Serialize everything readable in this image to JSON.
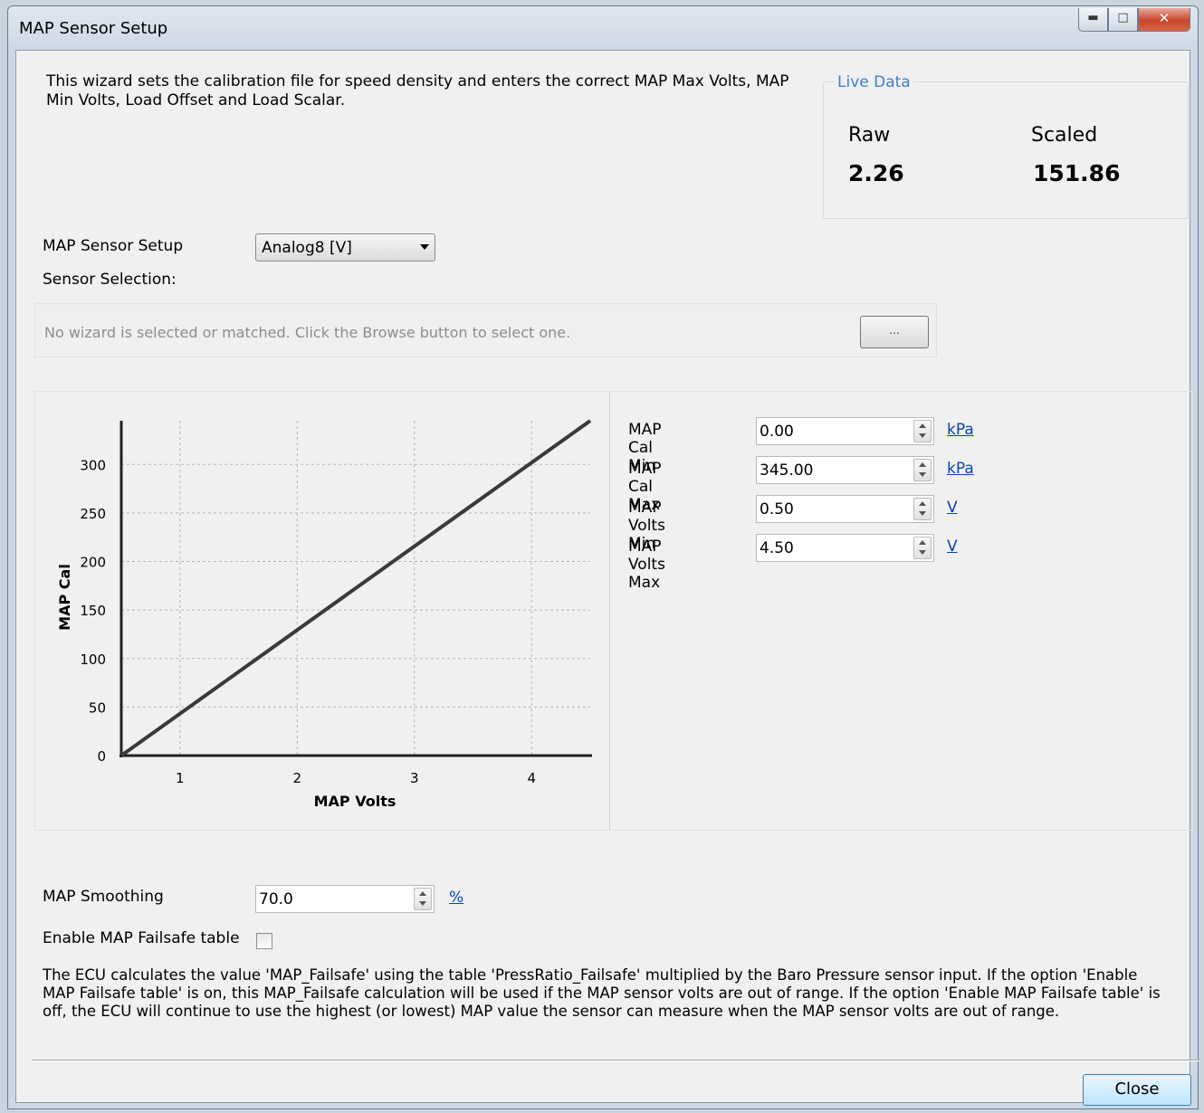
{
  "window": {
    "title": "MAP Sensor Setup",
    "controls": {
      "minimize": "minimize-icon",
      "maximize": "maximize-icon",
      "close": "close-icon"
    }
  },
  "intro_text": "This wizard sets the calibration file for speed density and enters the correct MAP Max Volts, MAP Min Volts, Load Offset and Load Scalar.",
  "live_data": {
    "label": "Live Data",
    "raw_label": "Raw",
    "raw_value": "2.26",
    "scaled_label": "Scaled",
    "scaled_value": "151.86"
  },
  "map_sensor_setup": {
    "label": "MAP Sensor Setup",
    "selected": "Analog8 [V]"
  },
  "sensor_selection": {
    "label": "Sensor Selection:",
    "message": "No wizard is selected or matched. Click the Browse button to select one.",
    "browse_label": "..."
  },
  "fields": [
    {
      "label": "MAP Cal Min",
      "value": "0.00",
      "unit": "kPa"
    },
    {
      "label": "MAP Cal Max",
      "value": "345.00",
      "unit": "kPa"
    },
    {
      "label": "MAP Volts Min",
      "value": "0.50",
      "unit": "V"
    },
    {
      "label": "MAP Volts Max",
      "value": "4.50",
      "unit": "V"
    }
  ],
  "chart_data": {
    "type": "line",
    "xlabel": "MAP Volts",
    "ylabel": "MAP Cal",
    "xlim": [
      0.5,
      4.5
    ],
    "ylim": [
      0,
      345
    ],
    "xticks": [
      1,
      2,
      3,
      4
    ],
    "yticks": [
      0,
      50,
      100,
      150,
      200,
      250,
      300
    ],
    "grid": true,
    "series": [
      {
        "x": [
          0.5,
          4.5
        ],
        "y": [
          0,
          345
        ],
        "color": "#3a3a3a"
      }
    ]
  },
  "smoothing": {
    "label": "MAP Smoothing",
    "value": "70.0",
    "unit": "%"
  },
  "failsafe": {
    "label": "Enable MAP Failsafe table",
    "checked": false
  },
  "description": "The ECU calculates the value 'MAP_Failsafe' using the table 'PressRatio_Failsafe' multiplied by the Baro Pressure sensor input. If the option 'Enable MAP Failsafe table' is on, this MAP_Failsafe calculation will be used if the MAP sensor volts are out of range. If the option 'Enable MAP Failsafe table' is off, the ECU will continue to use the highest (or lowest) MAP value the sensor can measure when the MAP sensor volts are out of range.",
  "close_label": "Close"
}
